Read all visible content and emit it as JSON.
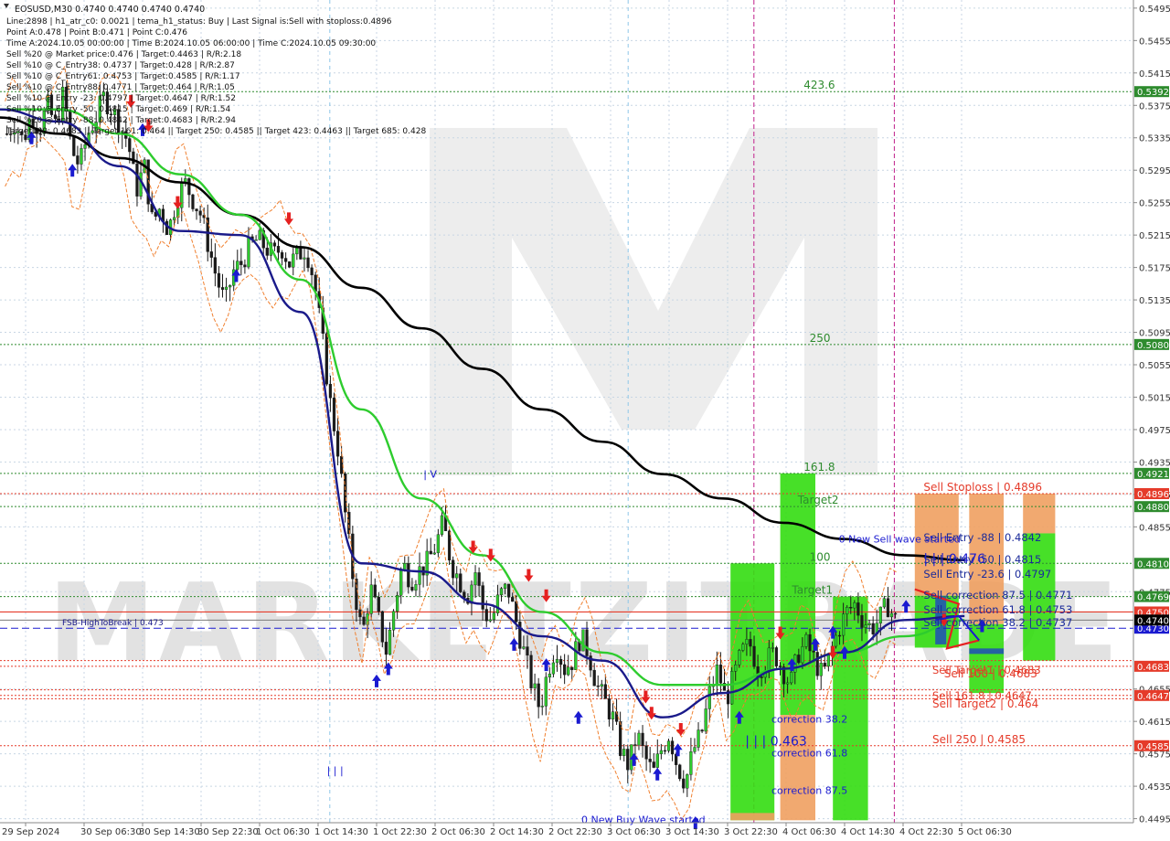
{
  "chart_data": {
    "type": "candlestick",
    "symbol_line": "EOSUSD,M30  0.4740 0.4740 0.4740 0.4740",
    "info_lines": [
      "Line:2898  | h1_atr_c0: 0.0021  | tema_h1_status: Buy  | Last Signal is:Sell with stoploss:0.4896",
      "Point A:0.478  | Point B:0.471  | Point C:0.476",
      "Time A:2024.10.05 00:00:00  | Time B:2024.10.05 06:00:00  | Time C:2024.10.05 09:30:00",
      "Sell %20 @ Market price:0.476  | Target:0.4463  | R/R:2.18",
      "Sell %10 @ C_Entry38: 0.4737  | Target:0.428  | R/R:2.87",
      "Sell %10 @ C_Entry61: 0.4753  | Target:0.4585  | R/R:1.17",
      "Sell %10 @ C_Entry88: 0.4771  | Target:0.464  | R/R:1.05",
      "Sell %10 @ Entry -23: 0.4797  | Target:0.4647  | R/R:1.52",
      "Sell %10 @ Entry -50: 0.4815  | Target:0.469  | R/R:1.54",
      "Sell %20 @ Entry -88: 0.4842  | Target:0.4683  | R/R:2.94",
      "Target100: 0.4683  || Target 161: 0.464  || Target 250: 0.4585  || Target 423: 0.4463  || Target 685: 0.428"
    ],
    "x_labels": [
      "29 Sep 2024",
      "30 Sep 06:30",
      "30 Sep 14:30",
      "30 Sep 22:30",
      "1 Oct 06:30",
      "1 Oct 14:30",
      "1 Oct 22:30",
      "2 Oct 06:30",
      "2 Oct 14:30",
      "2 Oct 22:30",
      "3 Oct 06:30",
      "3 Oct 14:30",
      "3 Oct 22:30",
      "4 Oct 06:30",
      "4 Oct 14:30",
      "4 Oct 22:30",
      "5 Oct 06:30"
    ],
    "y_ticks": [
      "0.5495",
      "0.5455",
      "0.5415",
      "0.5375",
      "0.5335",
      "0.5295",
      "0.5255",
      "0.5215",
      "0.5175",
      "0.5135",
      "0.5095",
      "0.5055",
      "0.5015",
      "0.4975",
      "0.4935",
      "0.4895",
      "0.4855",
      "0.4775",
      "0.4655",
      "0.4615",
      "0.4575",
      "0.4535",
      "0.4495"
    ],
    "ylim": [
      0.449,
      0.5505
    ],
    "close_path": [
      0.534,
      0.5355,
      0.533,
      0.5365,
      0.5345,
      0.5375,
      0.535,
      0.539,
      0.532,
      0.53,
      0.534,
      0.536,
      0.5385,
      0.537,
      0.535,
      0.533,
      0.527,
      0.53,
      0.523,
      0.525,
      0.522,
      0.526,
      0.528,
      0.526,
      0.524,
      0.52,
      0.516,
      0.513,
      0.517,
      0.518,
      0.52,
      0.521,
      0.52,
      0.519,
      0.52,
      0.518,
      0.519,
      0.52,
      0.516,
      0.509,
      0.501,
      0.495,
      0.486,
      0.478,
      0.472,
      0.478,
      0.474,
      0.47,
      0.476,
      0.481,
      0.479,
      0.48,
      0.481,
      0.483,
      0.486,
      0.481,
      0.479,
      0.477,
      0.48,
      0.475,
      0.474,
      0.477,
      0.478,
      0.474,
      0.47,
      0.466,
      0.463,
      0.468,
      0.471,
      0.468,
      0.469,
      0.472,
      0.47,
      0.466,
      0.464,
      0.462,
      0.458,
      0.456,
      0.46,
      0.457,
      0.455,
      0.458,
      0.46,
      0.456,
      0.454,
      0.458,
      0.46,
      0.465,
      0.468,
      0.464,
      0.467,
      0.47,
      0.471,
      0.468,
      0.469,
      0.47,
      0.468,
      0.466,
      0.47,
      0.471,
      0.469,
      0.467,
      0.47,
      0.473,
      0.475,
      0.476,
      0.474,
      0.473,
      0.474,
      0.476,
      0.474
    ],
    "series": [
      {
        "name": "",
        "color": "#000000",
        "values": [
          0.536,
          0.534,
          0.531,
          0.528,
          0.524,
          0.52,
          0.515,
          0.51,
          0.505,
          0.5,
          0.496,
          0.492,
          0.489,
          0.486,
          0.484,
          0.482,
          0.4814
        ]
      },
      {
        "name": "",
        "color": "#2ecc2e",
        "values": [
          0.537,
          0.537,
          0.534,
          0.529,
          0.524,
          0.516,
          0.5,
          0.489,
          0.482,
          0.475,
          0.47,
          0.466,
          0.466,
          0.468,
          0.47,
          0.472,
          0.474
        ]
      },
      {
        "name": "",
        "color": "#1a1a8a",
        "values": [
          0.537,
          0.5355,
          0.53,
          0.522,
          0.5215,
          0.512,
          0.481,
          0.48,
          0.476,
          0.472,
          0.469,
          0.462,
          0.465,
          0.468,
          0.47,
          0.474,
          0.4745
        ]
      }
    ],
    "levels": [
      {
        "label": "423.6",
        "price": 0.5392,
        "tag": "0.5392",
        "color": "#2e8b2e"
      },
      {
        "label": "250",
        "price": 0.508,
        "tag": "0.5080",
        "color": "#2e8b2e"
      },
      {
        "label": "161.8",
        "price": 0.4921,
        "tag": "0.4921",
        "color": "#2e8b2e"
      },
      {
        "label": "Sell Stoploss | 0.4896",
        "price": 0.4896,
        "tag": "0.4896",
        "color": "#e53b2a"
      },
      {
        "label": "Target2",
        "price": 0.488,
        "tag": "0.4880",
        "color": "#2e8b2e"
      },
      {
        "label": "100",
        "price": 0.481,
        "tag": "0.4810",
        "color": "#2e8b2e"
      },
      {
        "label": "Target1",
        "price": 0.4769,
        "tag": "0.4769",
        "color": "#2e8b2e"
      },
      {
        "label": "",
        "price": 0.475,
        "tag": "0.4750",
        "color": "#e53b2a"
      },
      {
        "label": "FSB-HighToBreak | 0.473",
        "price": 0.473,
        "tag": "0.4730",
        "color": "#1a1ad0"
      },
      {
        "label": "Sell 100 | 0.4683",
        "price": 0.4683,
        "tag": "0.4683",
        "color": "#e53b2a"
      },
      {
        "label": "Sell Target2 | 0.464",
        "price": 0.4647,
        "tag": "0.4647",
        "color": "#e53b2a"
      },
      {
        "label": "Sell 250 | 0.4585",
        "price": 0.4585,
        "tag": "0.4585",
        "color": "#e53b2a"
      }
    ],
    "zone_labels": [
      {
        "text": "Sell Entry -88 | 0.4842",
        "price": 0.4842
      },
      {
        "text": "Sell Entry -50 | 0.4815",
        "price": 0.4815
      },
      {
        "text": "Sell Entry -23.6 | 0.4797",
        "price": 0.4797
      },
      {
        "text": "Sell correction 87.5 | 0.4771",
        "price": 0.4771
      },
      {
        "text": "Sell correction 61.8 | 0.4753",
        "price": 0.4753
      },
      {
        "text": "Sell correction 38.2 | 0.4737",
        "price": 0.4737
      },
      {
        "text": "Sell Target1 | 0.4683",
        "price": 0.4683
      },
      {
        "text": "Sell 161.8 | 0.4647",
        "price": 0.4647
      }
    ],
    "annotations": [
      {
        "text": "0 New Sell wave started",
        "price": 0.484
      },
      {
        "text": "| | | 0.476",
        "price": 0.4815
      },
      {
        "text": "| | | 0.463",
        "price": 0.459
      },
      {
        "text": "correction 38.2",
        "price": 0.4618
      },
      {
        "text": "correction 61.8",
        "price": 0.4576
      },
      {
        "text": "correction 87.5",
        "price": 0.453
      },
      {
        "text": "| V",
        "price": 0.492
      },
      {
        "text": "| | |",
        "price": 0.4555
      },
      {
        "text": "0 New Buy Wave started",
        "price": 0.4494
      }
    ]
  },
  "watermark": "MARKETZITRADE",
  "colors": {
    "grid": "#c8d6e4",
    "axis_text": "#333333",
    "up_candle": "#2ecc2e",
    "down_candle": "#1a1a1a",
    "green_zone": "#33dd11",
    "orange_zone": "#f0a060",
    "sell_red": "#e53b2a",
    "level_green": "#2e8b2e",
    "current_price_bg": "#000000"
  },
  "current_price": {
    "price": 0.474,
    "tag": "0.4740"
  }
}
